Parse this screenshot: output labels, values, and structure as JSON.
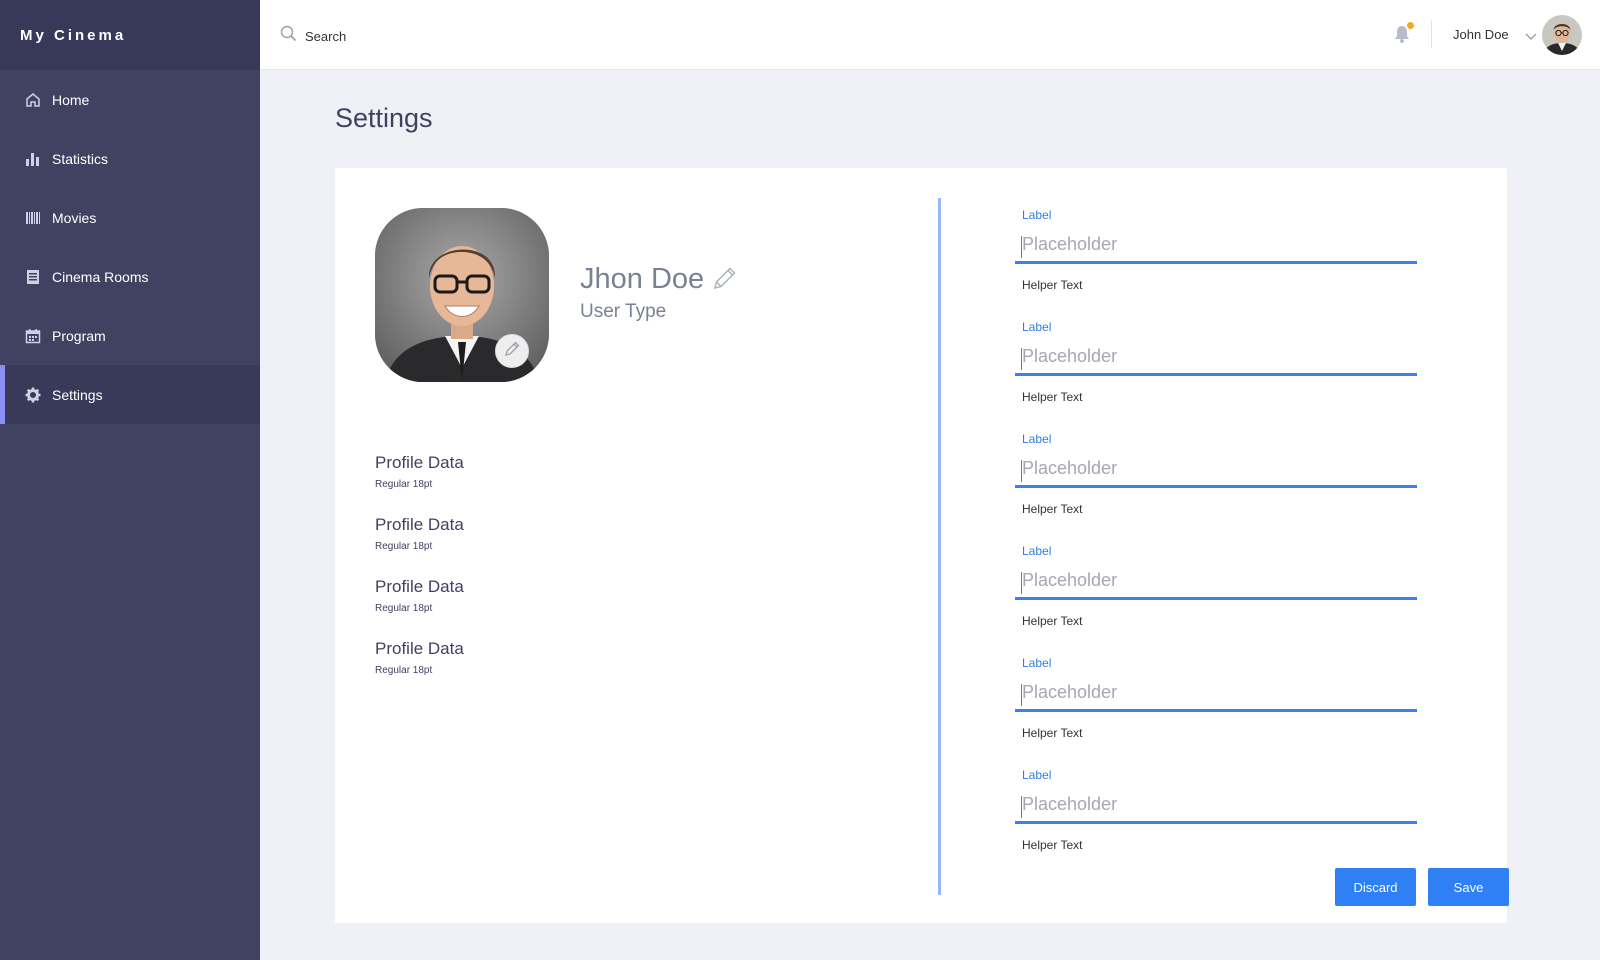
{
  "brand": "My Cinema",
  "sidebar": {
    "items": [
      {
        "label": "Home"
      },
      {
        "label": "Statistics"
      },
      {
        "label": "Movies"
      },
      {
        "label": "Cinema Rooms"
      },
      {
        "label": "Program"
      },
      {
        "label": "Settings"
      }
    ],
    "active_index": 5
  },
  "topbar": {
    "search_placeholder": "Search",
    "user_name": "John Doe"
  },
  "page": {
    "title": "Settings"
  },
  "profile": {
    "name": "Jhon Doe",
    "user_type": "User Type",
    "data": [
      {
        "title": "Profile Data",
        "subtitle": "Regular 18pt"
      },
      {
        "title": "Profile Data",
        "subtitle": "Regular 18pt"
      },
      {
        "title": "Profile Data",
        "subtitle": "Regular 18pt"
      },
      {
        "title": "Profile Data",
        "subtitle": "Regular 18pt"
      }
    ]
  },
  "form": {
    "fields": [
      {
        "label": "Label",
        "placeholder": "Placeholder",
        "helper": "Helper Text"
      },
      {
        "label": "Label",
        "placeholder": "Placeholder",
        "helper": "Helper Text"
      },
      {
        "label": "Label",
        "placeholder": "Placeholder",
        "helper": "Helper Text"
      },
      {
        "label": "Label",
        "placeholder": "Placeholder",
        "helper": "Helper Text"
      },
      {
        "label": "Label",
        "placeholder": "Placeholder",
        "helper": "Helper Text"
      },
      {
        "label": "Label",
        "placeholder": "Placeholder",
        "helper": "Helper Text"
      }
    ],
    "discard_label": "Discard",
    "save_label": "Save"
  },
  "colors": {
    "sidebar_bg": "#414162",
    "accent": "#2f7ff5",
    "active_indicator": "#8b8ff5",
    "notification_dot": "#f5a623"
  },
  "icons": {
    "nav": [
      "home-icon",
      "statistics-icon",
      "movies-icon",
      "cinema-rooms-icon",
      "program-icon",
      "settings-icon"
    ],
    "search": "search-icon",
    "notifications": "bell-icon",
    "user_menu": "chevron-down-icon",
    "edit": "pencil-icon"
  }
}
